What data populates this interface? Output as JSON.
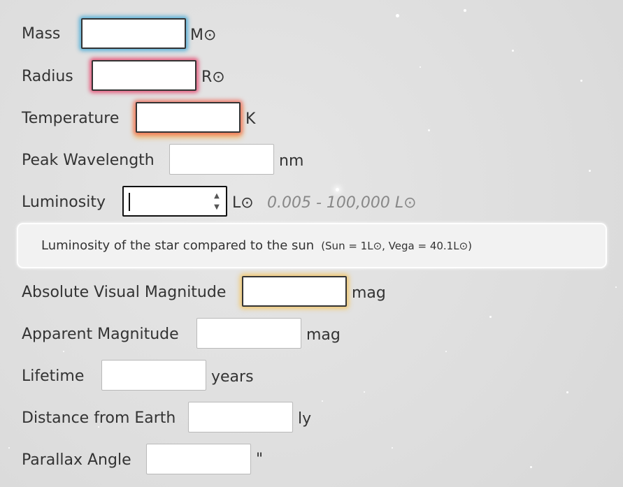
{
  "fields": [
    {
      "key": "mass",
      "label": "Mass",
      "unit": "M⊙",
      "value": ""
    },
    {
      "key": "radius",
      "label": "Radius",
      "unit": "R⊙",
      "value": ""
    },
    {
      "key": "temperature",
      "label": "Temperature",
      "unit": "K",
      "value": ""
    },
    {
      "key": "peak_wavelength",
      "label": "Peak Wavelength",
      "unit": "nm",
      "value": ""
    },
    {
      "key": "luminosity",
      "label": "Luminosity",
      "unit": "L⊙",
      "value": "",
      "range": "0.005 - 100,000 L⊙"
    },
    {
      "key": "absolute_visual_magnitude",
      "label": "Absolute Visual Magnitude",
      "unit": "mag",
      "value": ""
    },
    {
      "key": "apparent_magnitude",
      "label": "Apparent Magnitude",
      "unit": "mag",
      "value": ""
    },
    {
      "key": "lifetime",
      "label": "Lifetime",
      "unit": "years",
      "value": ""
    },
    {
      "key": "distance",
      "label": "Distance from Earth",
      "unit": "ly",
      "value": ""
    },
    {
      "key": "parallax",
      "label": "Parallax Angle",
      "unit": "\"",
      "value": ""
    }
  ],
  "info": {
    "text": "Luminosity of the star compared to the sun",
    "note": "(Sun = 1L⊙, Vega = 40.1L⊙)"
  },
  "colors": {
    "highlight_blue": "#46aad7",
    "highlight_red": "#e6466e",
    "highlight_orange": "#f5aa3c",
    "highlight_yellow": "#f5c35a"
  },
  "icons": {
    "spinner_up": "triangle-up",
    "spinner_down": "triangle-down"
  }
}
